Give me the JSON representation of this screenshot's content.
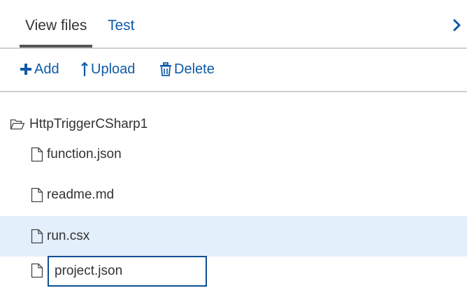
{
  "tabs": [
    {
      "label": "View files",
      "active": true
    },
    {
      "label": "Test",
      "active": false
    }
  ],
  "toolbar": {
    "add_label": "Add",
    "upload_label": "Upload",
    "delete_label": "Delete"
  },
  "tree": {
    "folder_name": "HttpTriggerCSharp1",
    "files": [
      {
        "name": "function.json",
        "selected": false
      },
      {
        "name": "readme.md",
        "selected": false
      },
      {
        "name": "run.csx",
        "selected": true
      }
    ],
    "rename_value": "project.json"
  },
  "icons": {
    "chevron": "chevron-right-icon",
    "add": "plus-icon",
    "upload": "upload-arrow-icon",
    "delete": "trash-icon",
    "folder": "folder-open-icon",
    "file": "file-icon"
  },
  "colors": {
    "accent": "#0d5aa7",
    "selected_row": "#e3effb",
    "rename_border": "#0d4f93"
  }
}
